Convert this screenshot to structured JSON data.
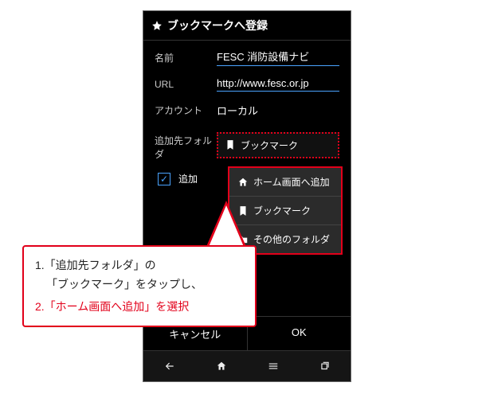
{
  "dialog": {
    "title": "ブックマークへ登録"
  },
  "fields": {
    "name_label": "名前",
    "name_value": "FESC 消防設備ナビ",
    "url_label": "URL",
    "url_value": "http://www.fesc.or.jp",
    "account_label": "アカウント",
    "account_value": "ローカル",
    "folder_label": "追加先フォルダ",
    "folder_value": "ブックマーク",
    "checkbox_label": "追加"
  },
  "dropdown": {
    "items": [
      {
        "icon": "home-plus",
        "label": "ホーム画面へ追加"
      },
      {
        "icon": "bookmark",
        "label": "ブックマーク"
      },
      {
        "icon": "folder",
        "label": "その他のフォルダ"
      }
    ]
  },
  "buttons": {
    "cancel": "キャンセル",
    "ok": "OK"
  },
  "callout": {
    "line1a": "1.「追加先フォルダ」の",
    "line1b": "「ブックマーク」をタップし、",
    "line2": "2.「ホーム画面へ追加」を選択"
  }
}
